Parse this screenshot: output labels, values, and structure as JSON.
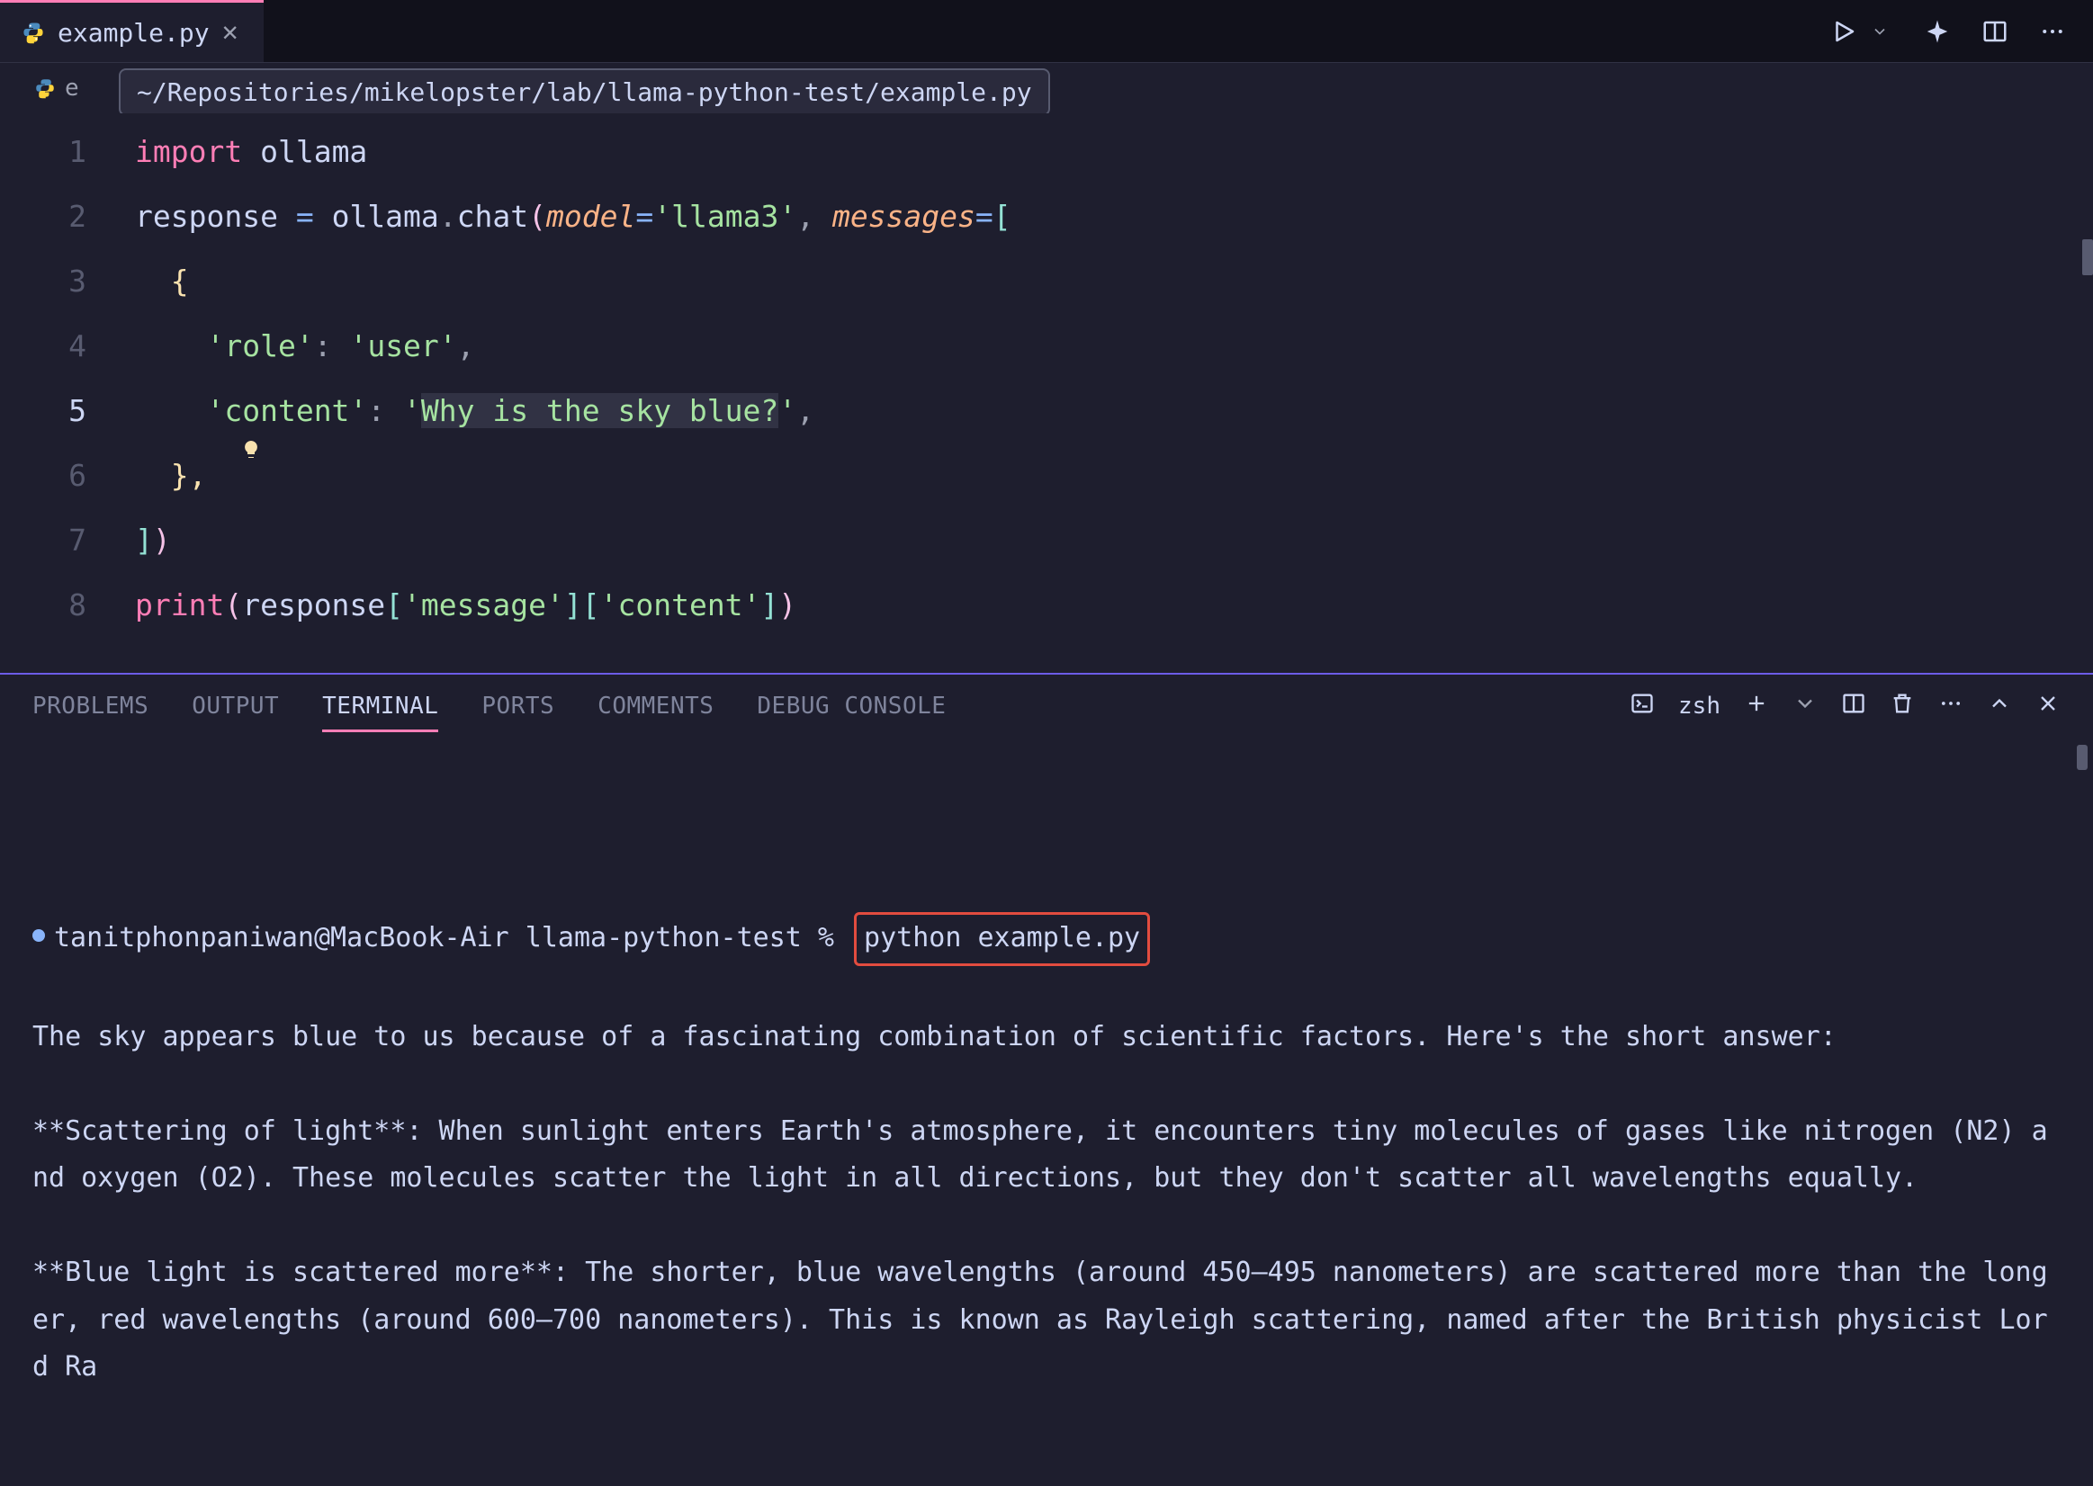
{
  "tab": {
    "filename": "example.py",
    "breadcrumb_truncated": "e",
    "path_tooltip": "~/Repositories/mikelopster/lab/llama-python-test/example.py"
  },
  "toolbar": {
    "shell_label": "zsh"
  },
  "editor": {
    "lines": [
      "1",
      "2",
      "3",
      "4",
      "5",
      "6",
      "7",
      "8"
    ],
    "line1_import": "import",
    "line1_module": "ollama",
    "line2_var": "response",
    "line2_eq": "=",
    "line2_mod": "ollama",
    "line2_dot": ".",
    "line2_fn": "chat",
    "line2_p_model": "model",
    "line2_model_val": "'llama3'",
    "line2_p_messages": "messages",
    "line3_brace": "{",
    "line4_key": "'role'",
    "line4_val": "'user'",
    "line5_key": "'content'",
    "line5_val_prefix": "'",
    "line5_val_hl": "Why is the sky blue?",
    "line5_val_suffix": "'",
    "line6_brace": "},",
    "line7": "])",
    "line8_print": "print",
    "line8_var": "response",
    "line8_k1": "'message'",
    "line8_k2": "'content'"
  },
  "panel": {
    "tabs": {
      "problems": "PROBLEMS",
      "output": "OUTPUT",
      "terminal": "TERMINAL",
      "ports": "PORTS",
      "comments": "COMMENTS",
      "debug": "DEBUG CONSOLE"
    }
  },
  "terminal": {
    "prompt": "tanitphonpaniwan@MacBook-Air llama-python-test % ",
    "command": "python example.py",
    "output_para1": "The sky appears blue to us because of a fascinating combination of scientific factors. Here's the short answer:",
    "output_para2": "**Scattering of light**: When sunlight enters Earth's atmosphere, it encounters tiny molecules of gases like nitrogen (N2) and oxygen (O2). These molecules scatter the light in all directions, but they don't scatter all wavelengths equally.",
    "output_para3": "**Blue light is scattered more**: The shorter, blue wavelengths (around 450–495 nanometers) are scattered more than the longer, red wavelengths (around 600–700 nanometers). This is known as Rayleigh scattering, named after the British physicist Lord Ra"
  }
}
